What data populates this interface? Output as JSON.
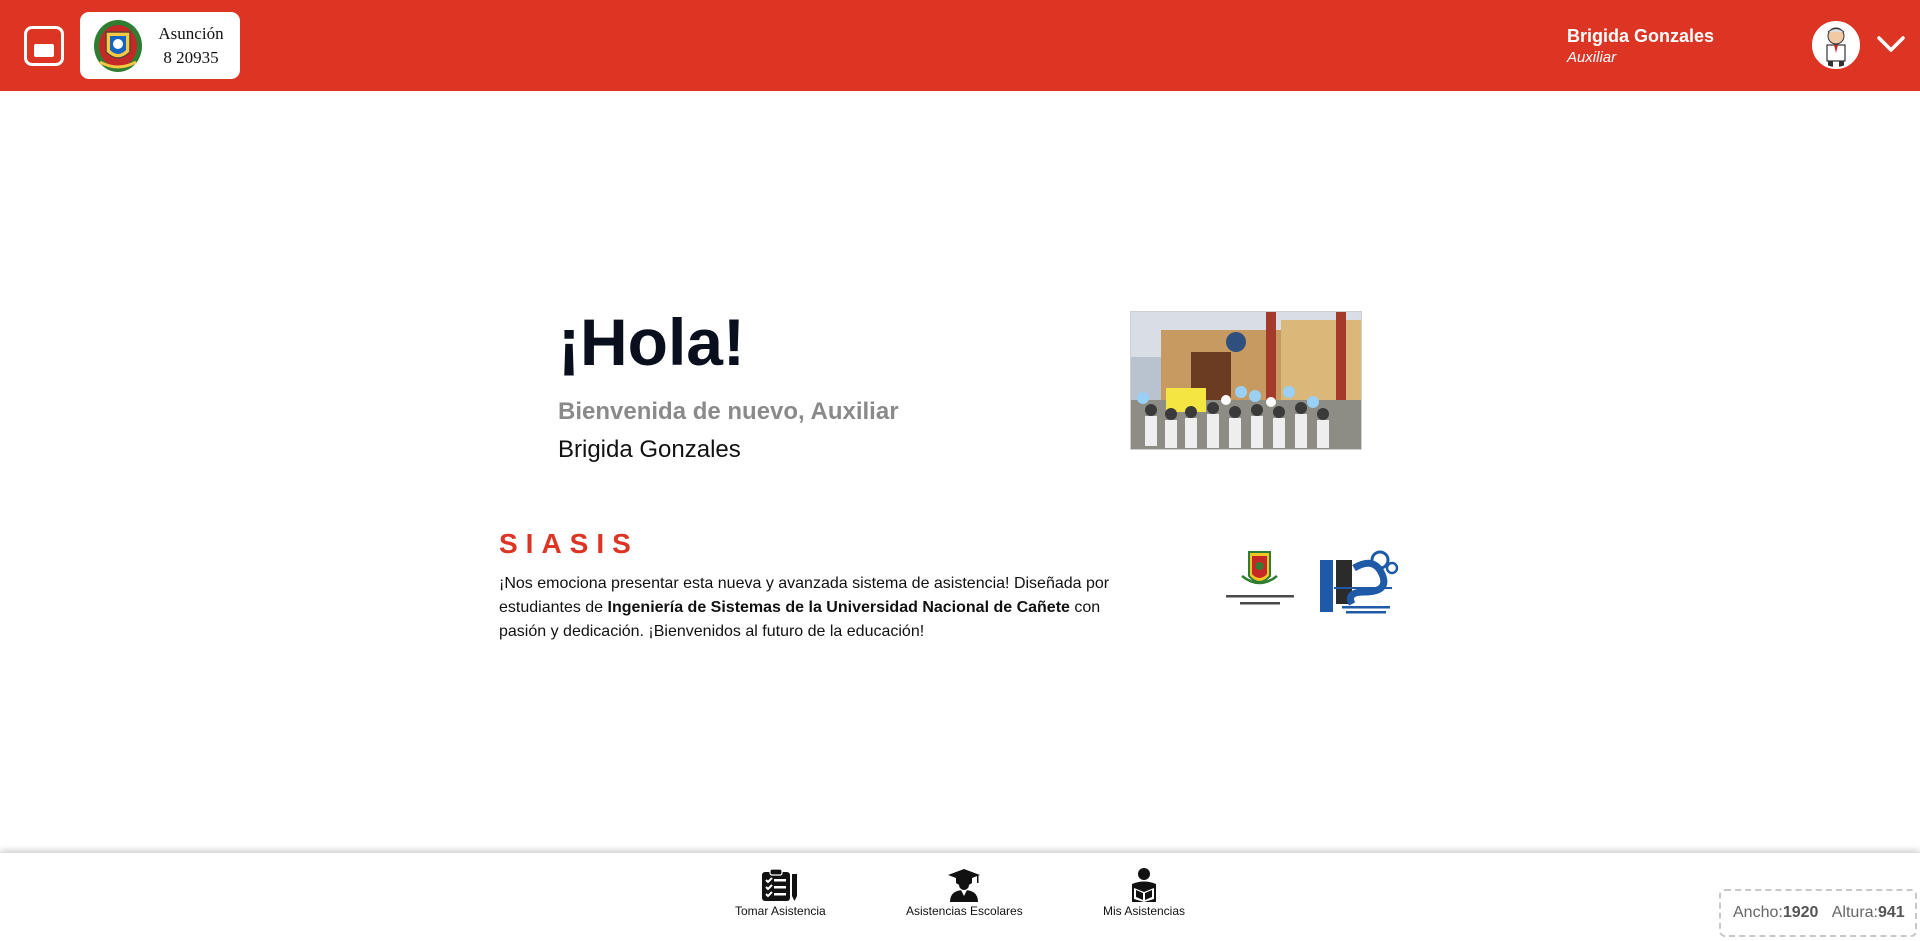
{
  "header": {
    "school_name": "Asunción",
    "school_number": "8 20935",
    "user_name": "Brigida Gonzales",
    "user_role": "Auxiliar",
    "brand_color": "#dd3524",
    "menu_icon": "sidebar-toggle-icon",
    "dropdown_icon": "chevron-down-icon"
  },
  "welcome": {
    "greeting": "¡Hola!",
    "subtitle": "Bienvenida de nuevo, Auxiliar",
    "name": "Brigida Gonzales"
  },
  "about": {
    "title": "SIASIS",
    "desc_part1": "¡Nos emociona presentar esta nueva y avanzada sistema de asistencia! Diseñada por estudiantes de ",
    "desc_bold": "Ingeniería de Sistemas de la Universidad Nacional de Cañete",
    "desc_part2": " con pasión y dedicación. ¡Bienvenidos al futuro de la educación!"
  },
  "nav": {
    "items": [
      {
        "label": "Tomar Asistencia",
        "icon": "clipboard-checklist-icon"
      },
      {
        "label": "Asistencias Escolares",
        "icon": "graduate-icon"
      },
      {
        "label": "Mis Asistencias",
        "icon": "reading-person-icon"
      }
    ]
  },
  "viewport": {
    "width_label": "Ancho:",
    "width_value": "1920",
    "height_label": "Altura:",
    "height_value": "941"
  }
}
